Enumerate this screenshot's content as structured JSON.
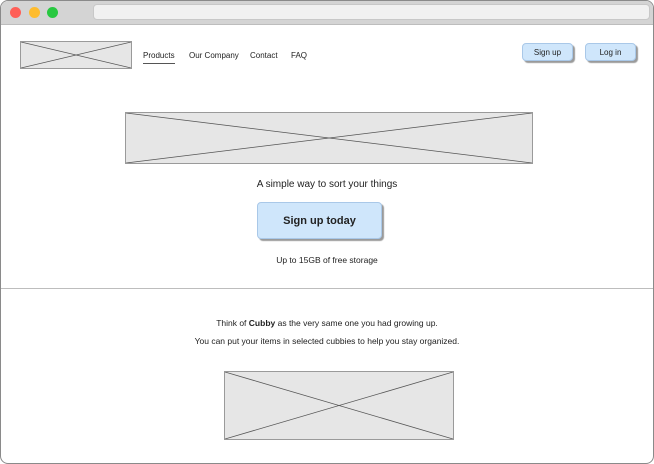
{
  "nav": {
    "items": [
      "Products",
      "Our Company",
      "Contact",
      "FAQ"
    ],
    "active_index": 0
  },
  "header": {
    "signup_label": "Sign up",
    "login_label": "Log in"
  },
  "hero": {
    "tagline": "A simple way to sort your things",
    "cta_label": "Sign up today",
    "storage_note": "Up to 15GB of free storage"
  },
  "about": {
    "line1_prefix": "Think of ",
    "line1_brand": "Cubby",
    "line1_suffix": " as the very same one you had growing up.",
    "line2": "You can put your items in selected cubbies to help you stay organized."
  },
  "colors": {
    "button_fill": "#cfe6fb",
    "placeholder_fill": "#e6e6e6"
  }
}
